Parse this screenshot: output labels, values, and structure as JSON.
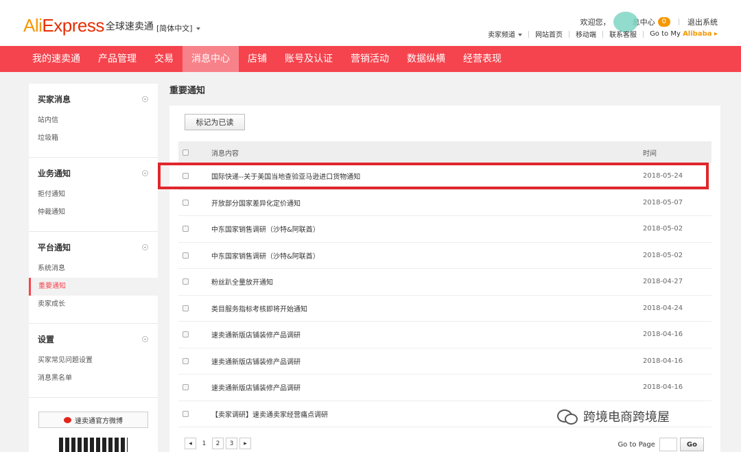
{
  "header": {
    "logo": "AliExpress",
    "logo_ali": "Ali",
    "logo_express": "Express",
    "logo_cn": "全球速卖通",
    "language": "[简体中文]",
    "welcome": "欢迎您，",
    "message_center": "息中心",
    "message_count": "0",
    "logout": "退出系统",
    "links": [
      "卖家频道",
      "网站首页",
      "移动端",
      "联系客服"
    ],
    "alibaba_prefix": "Go to My ",
    "alibaba": "Alibaba"
  },
  "nav": {
    "items": [
      "我的速卖通",
      "产品管理",
      "交易",
      "消息中心",
      "店铺",
      "账号及认证",
      "营销活动",
      "数据纵横",
      "经营表现"
    ],
    "active": "消息中心"
  },
  "sidebar": {
    "groups": [
      {
        "title": "买家消息",
        "links": [
          "站内信",
          "垃圾箱"
        ]
      },
      {
        "title": "业务通知",
        "links": [
          "拒付通知",
          "仲裁通知"
        ]
      },
      {
        "title": "平台通知",
        "links": [
          "系统消息",
          "重要通知",
          "卖家成长"
        ]
      },
      {
        "title": "设置",
        "links": [
          "买家常见问题设置",
          "消息黑名单"
        ]
      }
    ],
    "active_link": "重要通知",
    "weibo": "速卖通官方微博"
  },
  "main": {
    "title": "重要通知",
    "mark_read": "标记为已读",
    "columns": {
      "content": "消息内容",
      "time": "时间"
    },
    "rows": [
      {
        "content": "国际快递--关于美国当地查验亚马逊进口货物通知",
        "time": "2018-05-24"
      },
      {
        "content": "开放部分国家差异化定价通知",
        "time": "2018-05-07"
      },
      {
        "content": "中东国家销售调研（沙特&阿联酋）",
        "time": "2018-05-02"
      },
      {
        "content": "中东国家销售调研（沙特&阿联酋）",
        "time": "2018-05-02"
      },
      {
        "content": "粉丝趴全量放开通知",
        "time": "2018-04-27"
      },
      {
        "content": "类目服务指标考核即将开始通知",
        "time": "2018-04-24"
      },
      {
        "content": "速卖通新版店铺装修产品调研",
        "time": "2018-04-16"
      },
      {
        "content": "速卖通新版店铺装修产品调研",
        "time": "2018-04-16"
      },
      {
        "content": "速卖通新版店铺装修产品调研",
        "time": "2018-04-16"
      },
      {
        "content": "【卖家调研】速卖通卖家经营痛点调研",
        "time": ""
      }
    ],
    "pages": [
      "1",
      "2",
      "3"
    ],
    "go_to_page": "Go to Page",
    "go": "Go"
  },
  "watermark": "跨境电商跨境屋",
  "colors": {
    "nav_bg": "#f5444e",
    "nav_active": "#f8828a",
    "highlight": "#e0262b",
    "badge": "#f39800"
  }
}
